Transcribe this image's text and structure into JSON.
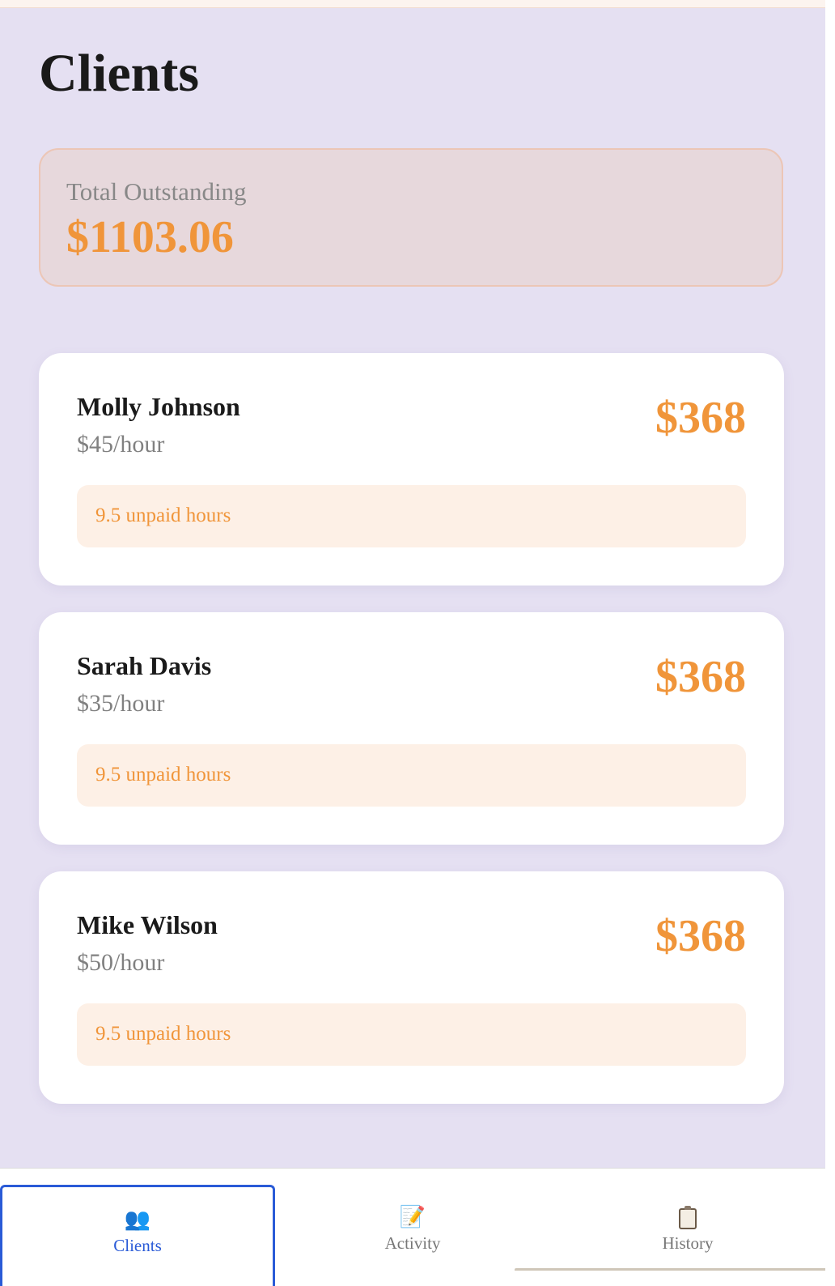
{
  "page": {
    "title": "Clients"
  },
  "summary": {
    "label": "Total Outstanding",
    "value": "$1103.06"
  },
  "clients": [
    {
      "name": "Molly Johnson",
      "rate": "$45/hour",
      "amount": "$368",
      "unpaid": "9.5 unpaid hours"
    },
    {
      "name": "Sarah Davis",
      "rate": "$35/hour",
      "amount": "$368",
      "unpaid": "9.5 unpaid hours"
    },
    {
      "name": "Mike Wilson",
      "rate": "$50/hour",
      "amount": "$368",
      "unpaid": "9.5 unpaid hours"
    }
  ],
  "tabs": [
    {
      "label": "Clients",
      "icon": "users-icon",
      "glyph": "👥",
      "active": true
    },
    {
      "label": "Activity",
      "icon": "memo-icon",
      "glyph": "📝",
      "active": false
    },
    {
      "label": "History",
      "icon": "clipboard-icon",
      "glyph": "",
      "active": false
    }
  ],
  "colors": {
    "accent": "#f0953a",
    "active_tab": "#2a5bd7",
    "background": "#e5e0f2"
  }
}
